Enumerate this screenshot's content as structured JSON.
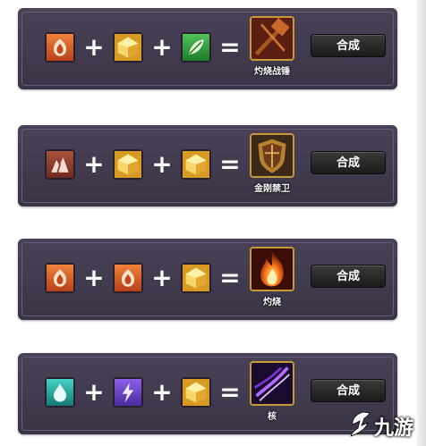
{
  "recipes": [
    {
      "ingredients": [
        "fire-emblem-icon",
        "gold-gem-icon",
        "leaf-emblem-icon"
      ],
      "operators": [
        "+",
        "+",
        "="
      ],
      "result": {
        "name": "灼烧战锤",
        "icon": "war-hammer-icon"
      },
      "button_label": "合成"
    },
    {
      "ingredients": [
        "mountain-emblem-icon",
        "gold-gem-icon",
        "gold-gem-icon"
      ],
      "operators": [
        "+",
        "+",
        "="
      ],
      "result": {
        "name": "金刚禁卫",
        "icon": "shield-icon"
      },
      "button_label": "合成"
    },
    {
      "ingredients": [
        "fire-emblem-icon",
        "fire-emblem-icon",
        "gold-gem-icon"
      ],
      "operators": [
        "+",
        "+",
        "="
      ],
      "result": {
        "name": "灼烧",
        "icon": "flame-icon"
      },
      "button_label": "合成"
    },
    {
      "ingredients": [
        "water-drop-emblem-icon",
        "lightning-emblem-icon",
        "gold-gem-icon"
      ],
      "operators": [
        "+",
        "+",
        "="
      ],
      "result": {
        "name": "核",
        "icon": "purple-slash-icon"
      },
      "button_label": "合成"
    }
  ],
  "watermark": {
    "text": "九游",
    "icon": "jiuyou-logo-icon"
  },
  "colors": {
    "panel": "#433b4f",
    "fire": "#d2591b",
    "gold": "#e7b93c",
    "leaf": "#2f9a3a",
    "mountain": "#8a3a2c",
    "water": "#24a7a0",
    "lightning": "#6a3fc9",
    "button": "#2a2a2a"
  }
}
